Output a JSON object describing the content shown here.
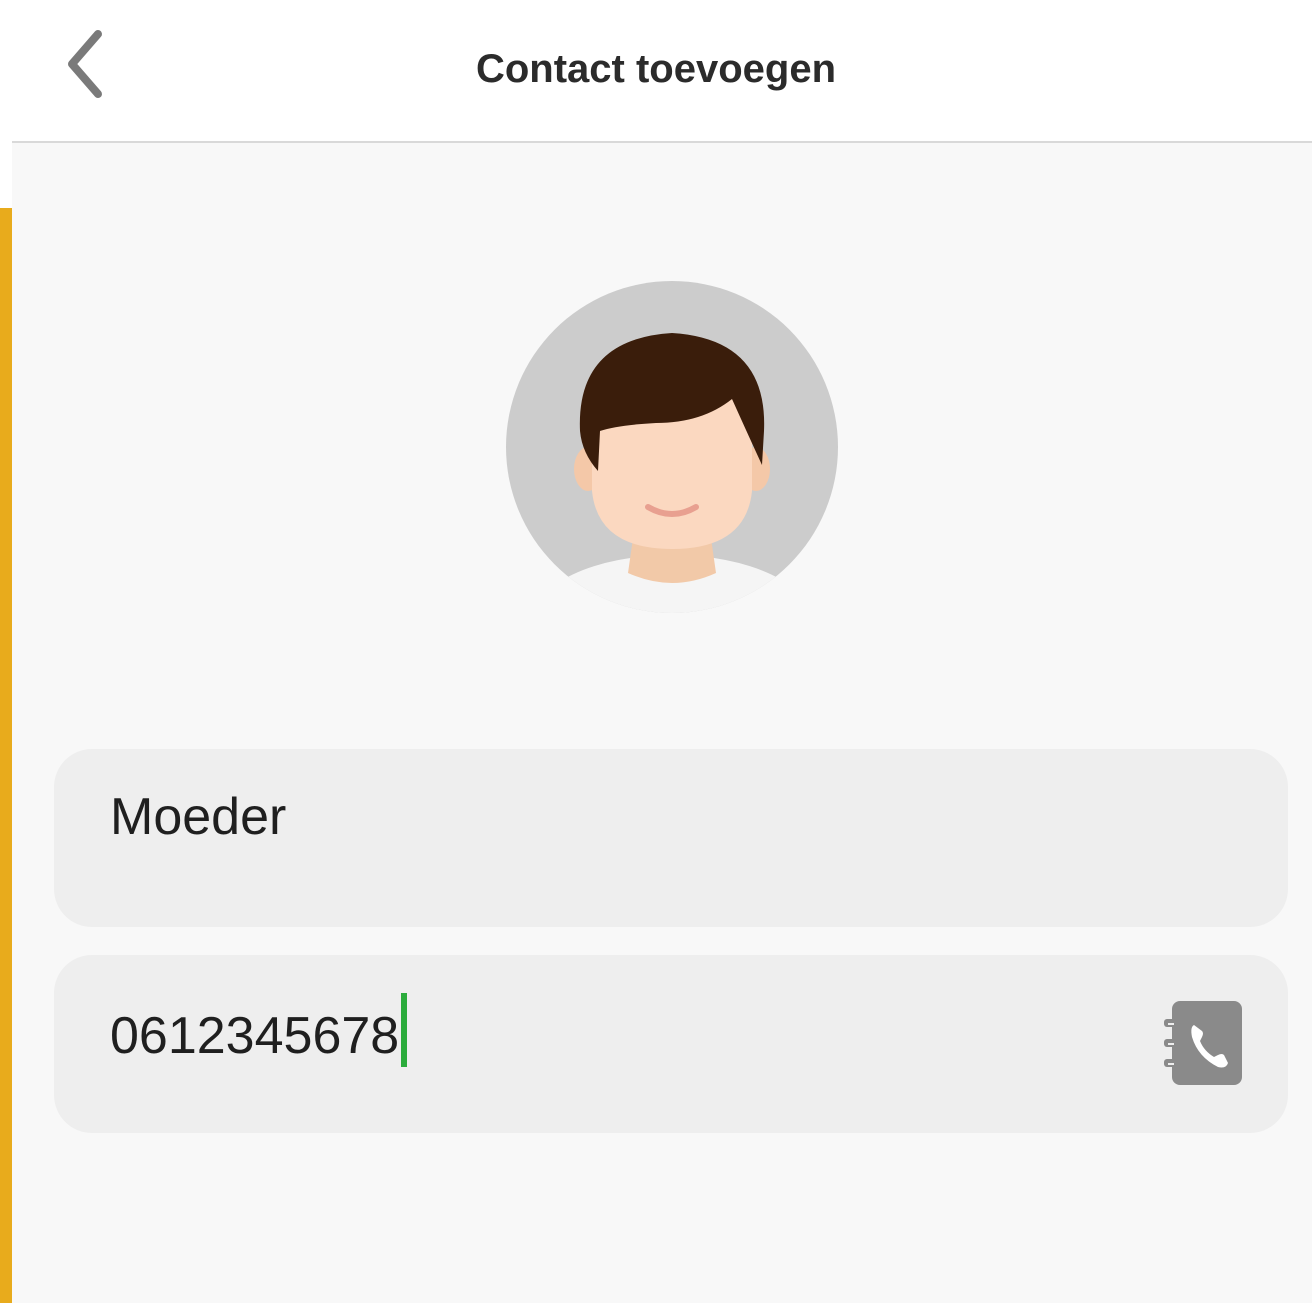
{
  "header": {
    "title": "Contact toevoegen",
    "back_icon": "chevron-left-icon"
  },
  "avatar": {
    "icon": "person-avatar-icon"
  },
  "form": {
    "name_value": "Moeder",
    "phone_value": "0612345678",
    "contacts_icon": "phonebook-icon"
  },
  "colors": {
    "accent": "#e8ab1c",
    "caret": "#2bab3b",
    "icon_gray": "#8a8a8a",
    "field_bg": "#eeeeee",
    "page_bg": "#f8f8f8"
  }
}
